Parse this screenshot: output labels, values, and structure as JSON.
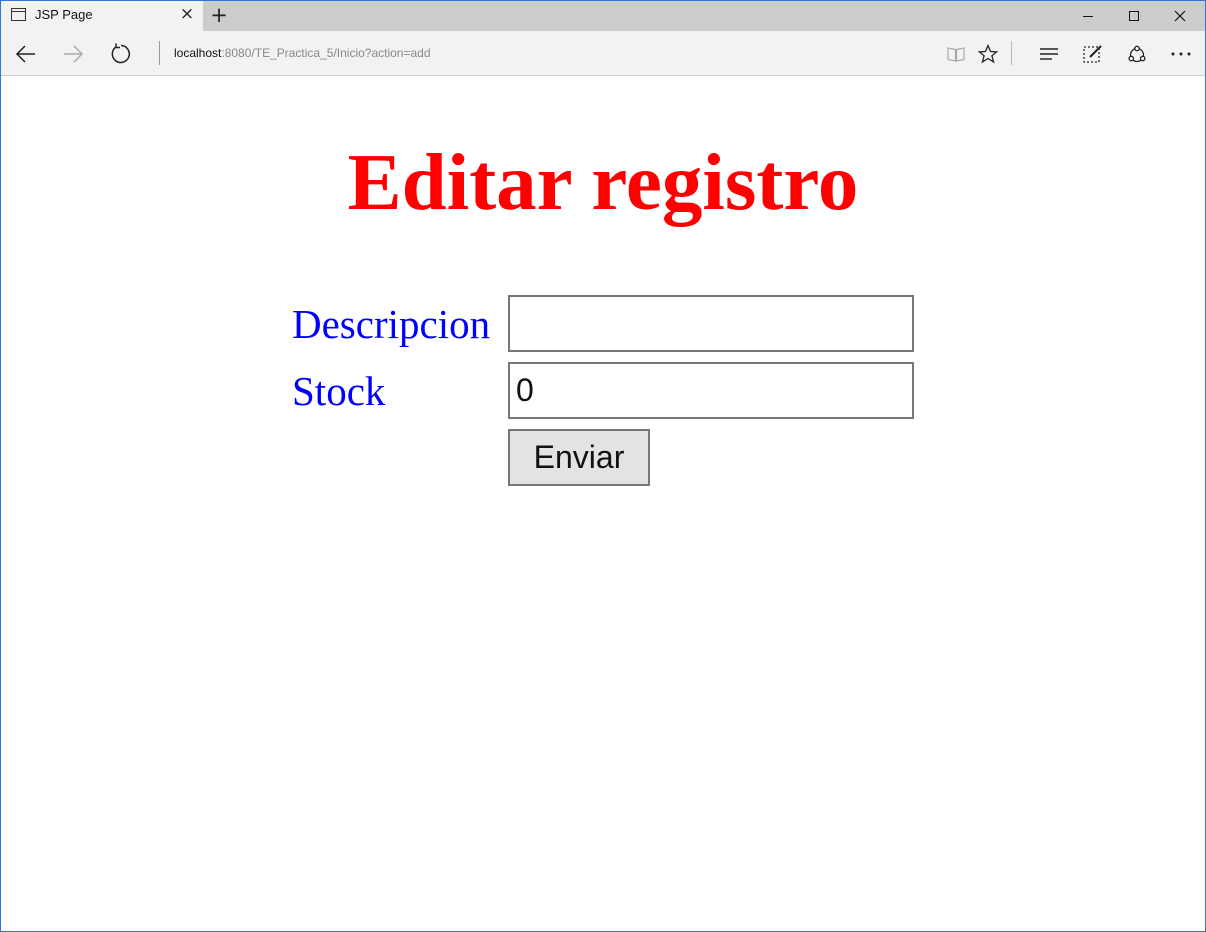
{
  "browser": {
    "tab": {
      "title": "JSP Page"
    },
    "address": {
      "host": "localhost",
      "rest": ":8080/TE_Practica_5/Inicio?action=add"
    }
  },
  "page": {
    "title": "Editar registro",
    "form": {
      "descripcion_label": "Descripcion",
      "descripcion_value": "",
      "stock_label": "Stock",
      "stock_value": "0",
      "submit_label": "Enviar"
    }
  }
}
